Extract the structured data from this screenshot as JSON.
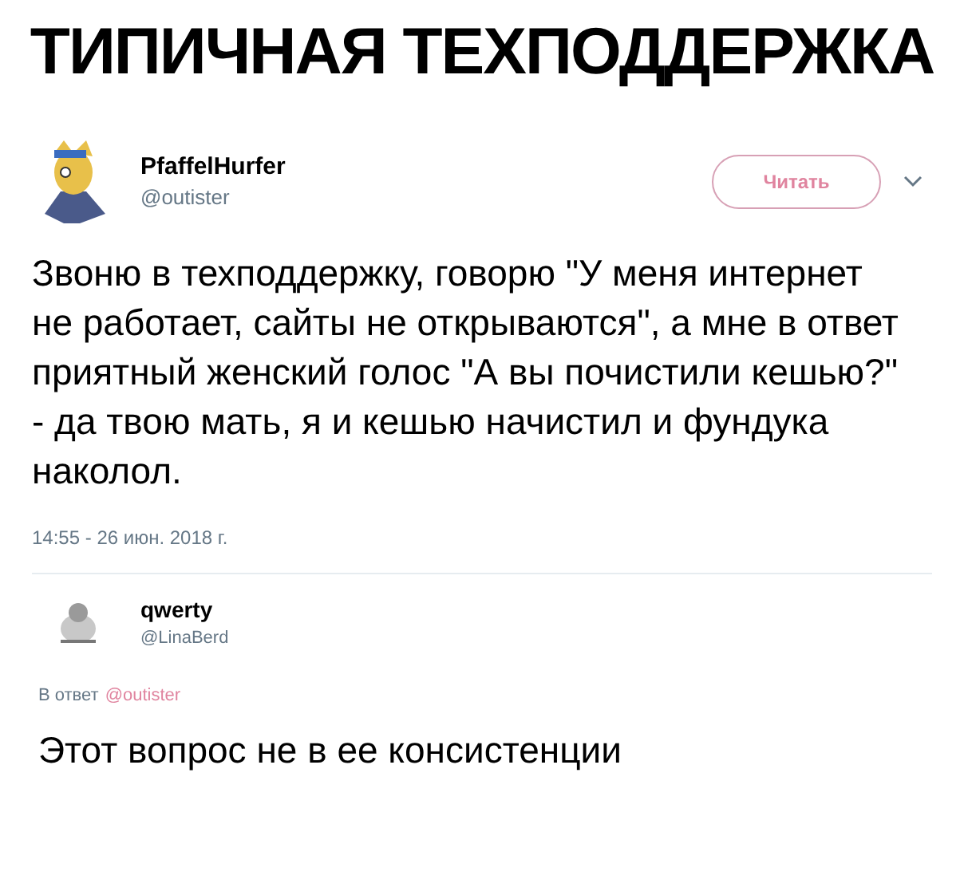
{
  "title": "ТИПИЧНАЯ ТЕХПОДДЕРЖКА",
  "tweet": {
    "name": "PfaffelHurfer",
    "handle": "@outister",
    "follow_button": "Читать",
    "text": "Звоню в техподдержку, говорю \"У меня интернет не работает, сайты не открываются\", а мне в ответ приятный женский голос \"А вы почистили кешью?\" - да твою мать, я и кешью начистил и фундука наколол.",
    "timestamp": "14:55 - 26 июн. 2018 г."
  },
  "reply": {
    "name": "qwerty",
    "handle": "@LinaBerd",
    "reply_to_label": "В ответ",
    "reply_to_handle": "@outister",
    "text": "Этот вопрос не в ее консистенции"
  }
}
